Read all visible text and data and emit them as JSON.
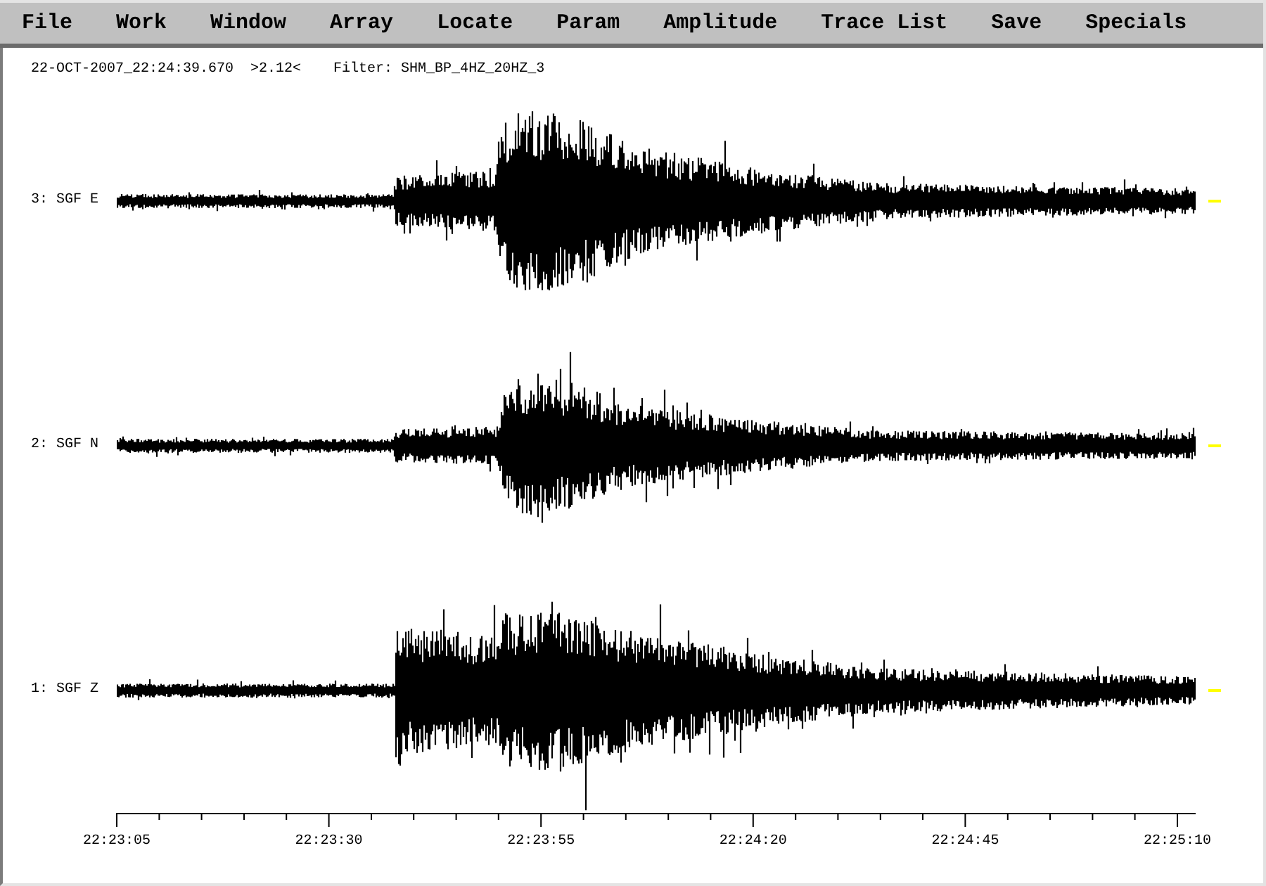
{
  "menu": [
    "File",
    "Work",
    "Window",
    "Array",
    "Locate",
    "Param",
    "Amplitude",
    "Trace List",
    "Save",
    "Specials"
  ],
  "header": {
    "timestamp": "22-OCT-2007_22:24:39.670",
    "scale": ">2.12<",
    "filter": "Filter: SHM_BP_4HZ_20HZ_3"
  },
  "traces": [
    {
      "label": "3: SGF E"
    },
    {
      "label": "2: SGF N"
    },
    {
      "label": "1: SGF Z"
    }
  ],
  "time_axis": {
    "labels": [
      "22:23:05",
      "22:23:30",
      "22:23:55",
      "22:24:20",
      "22:24:45",
      "22:25:10"
    ]
  }
}
